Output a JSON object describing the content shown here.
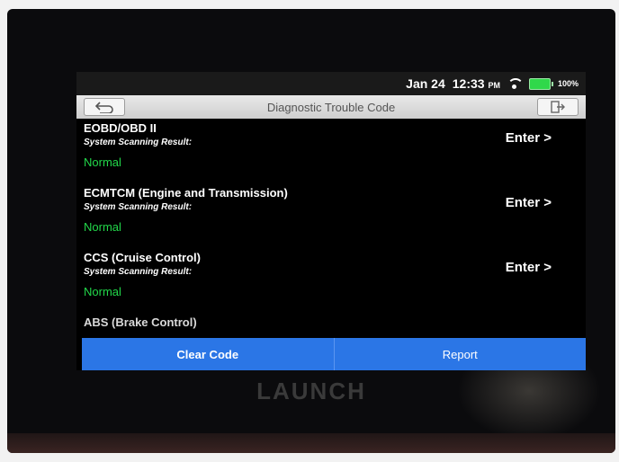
{
  "status": {
    "date": "Jan 24",
    "time": "12:33",
    "ampm": "PM",
    "battery": "100%"
  },
  "header": {
    "title": "Diagnostic Trouble Code"
  },
  "systems": [
    {
      "name": "EOBD/OBD II",
      "result_label": "System Scanning Result:",
      "status": "Normal",
      "action": "Enter >"
    },
    {
      "name": "ECMTCM (Engine and Transmission)",
      "result_label": "System Scanning Result:",
      "status": "Normal",
      "action": "Enter >"
    },
    {
      "name": "CCS (Cruise Control)",
      "result_label": "System Scanning Result:",
      "status": "Normal",
      "action": "Enter >"
    },
    {
      "name": "ABS (Brake Control)"
    }
  ],
  "actions": {
    "clear_code": "Clear Code",
    "report": "Report"
  },
  "device": {
    "brand": "LAUNCH"
  },
  "colors": {
    "accent": "#2b76e6",
    "status_ok": "#22d84a"
  }
}
